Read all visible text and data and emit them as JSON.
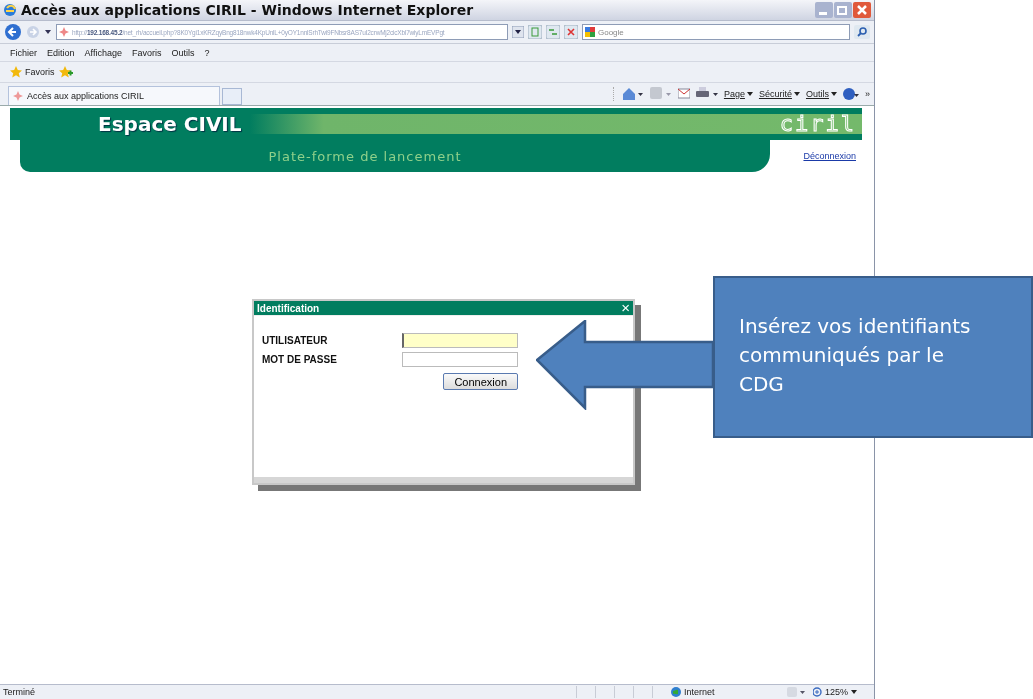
{
  "window": {
    "title": "Accès aux applications CIRIL - Windows Internet Explorer"
  },
  "address_bar": {
    "url": "http://**192.168.45.2**/net_rh/accueil.php?8K0Ygi1xKRZqyBng818nwk4KpUnlL+0yOY1nnlSrhTwi9FNbsr8AS7uI2crwMj2cicXbl7wiyLmEVPgt",
    "search_placeholder": "Google"
  },
  "menu": [
    "Fichier",
    "Edition",
    "Affichage",
    "Favoris",
    "Outils",
    "?"
  ],
  "favorites_bar": {
    "label": "Favoris"
  },
  "tabs": [
    {
      "label": "Accès aux applications CIRIL",
      "selected": true
    }
  ],
  "command_bar": [
    "Page",
    "Sécurité",
    "Outils"
  ],
  "command_more": "»",
  "header": {
    "title": "Espace CIVIL",
    "logo": "ciril",
    "subtitle": "Plate-forme de lancement",
    "logout": "Déconnexion"
  },
  "dialog": {
    "title": "Identification",
    "close": "×",
    "fields": [
      {
        "label": "UTILISATEUR",
        "focused": true
      },
      {
        "label": "MOT DE PASSE",
        "focused": false
      }
    ],
    "button": "Connexion"
  },
  "callout": {
    "text": "Insérez vos identifiants communiqués par le CDG"
  },
  "status_bar": {
    "status": "Terminé",
    "zone": "Internet",
    "zoom": "125%"
  }
}
